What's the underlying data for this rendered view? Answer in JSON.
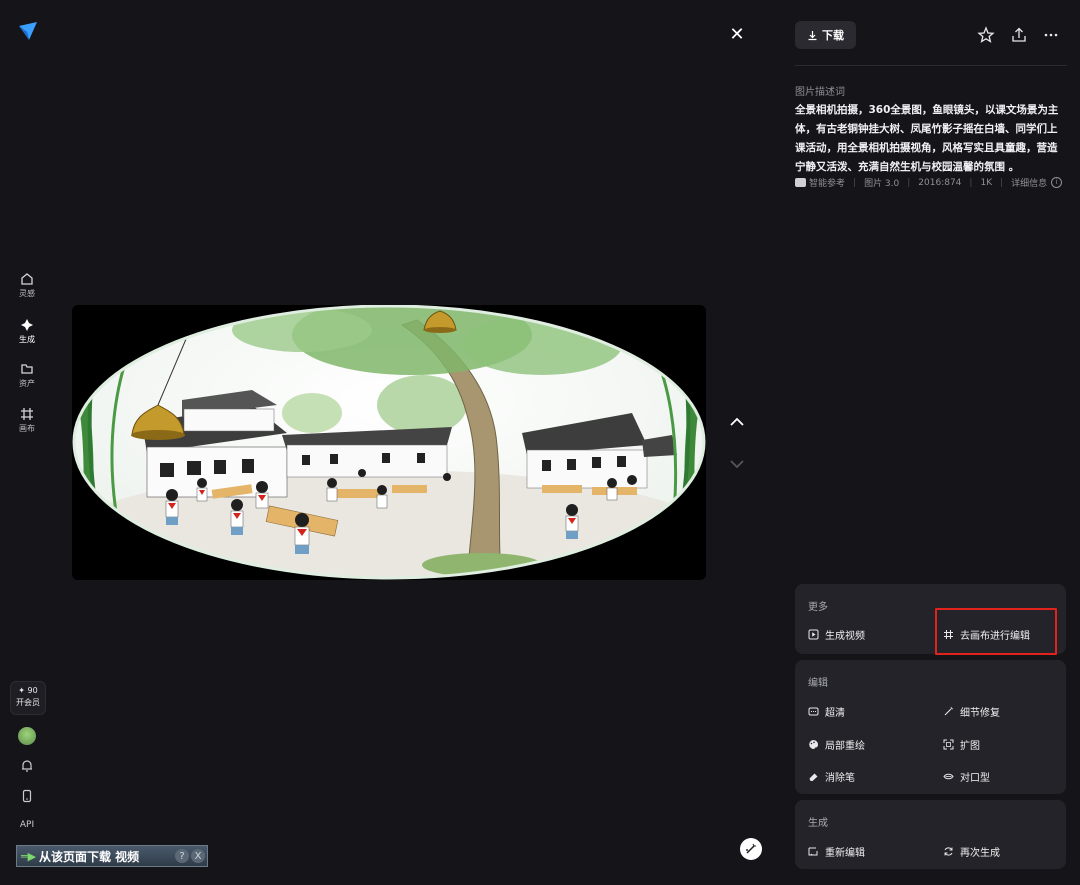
{
  "sidebar": {
    "items": [
      {
        "label": "灵感",
        "icon": "home-icon"
      },
      {
        "label": "生成",
        "icon": "sparkle-icon"
      },
      {
        "label": "资产",
        "icon": "folder-icon"
      },
      {
        "label": "画布",
        "icon": "canvas-icon"
      }
    ],
    "vip": {
      "points": "✦ 90",
      "label": "开会员"
    },
    "api_label": "API"
  },
  "download_banner": {
    "text": "从该页面下载 视频",
    "help": "?",
    "close": "X"
  },
  "viewer": {
    "close_symbol": "✕"
  },
  "toolbar": {
    "download_label": "下载"
  },
  "description": {
    "title": "图片描述词",
    "text": "全景相机拍摄，360全景图，鱼眼镜头，以课文场景为主体，有古老铜钟挂大树、凤尾竹影子摇在白墙、同学们上课活动，用全景相机拍摄视角，风格写实且具童趣，营造宁静又活泼、充满自然生机与校园温馨的氛围 。"
  },
  "meta": {
    "source": "智能参考",
    "model": "图片 3.0",
    "ratio": "2016:874",
    "resolution": "1K",
    "details": "详细信息"
  },
  "more_section": {
    "title": "更多",
    "actions": [
      {
        "label": "生成视频",
        "icon": "play-video-icon"
      },
      {
        "label": "去画布进行编辑",
        "icon": "canvas-icon"
      }
    ]
  },
  "edit_section": {
    "title": "编辑",
    "actions": [
      {
        "label": "超清",
        "icon": "hd-icon"
      },
      {
        "label": "细节修复",
        "icon": "magic-wand-icon"
      },
      {
        "label": "局部重绘",
        "icon": "palette-icon"
      },
      {
        "label": "扩图",
        "icon": "expand-icon"
      },
      {
        "label": "消除笔",
        "icon": "eraser-icon"
      },
      {
        "label": "对口型",
        "icon": "lip-sync-icon"
      }
    ]
  },
  "generate_section": {
    "title": "生成",
    "actions": [
      {
        "label": "重新编辑",
        "icon": "edit-icon"
      },
      {
        "label": "再次生成",
        "icon": "regenerate-icon"
      }
    ]
  }
}
